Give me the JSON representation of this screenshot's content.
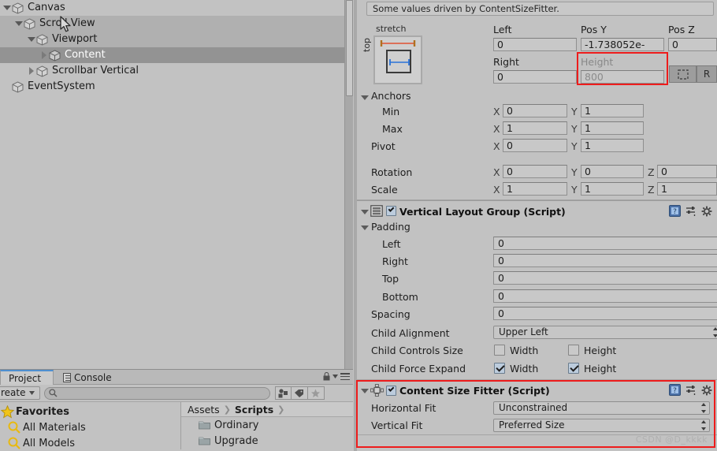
{
  "hierarchy": {
    "rows": [
      {
        "label": "Canvas",
        "indent": 0,
        "fold": "down",
        "state": "normal"
      },
      {
        "label": "Scroll View",
        "indent": 1,
        "fold": "down",
        "state": "light"
      },
      {
        "label": "Viewport",
        "indent": 2,
        "fold": "down",
        "state": "light"
      },
      {
        "label": "Content",
        "indent": 3,
        "fold": "right",
        "state": "dark"
      },
      {
        "label": "Scrollbar Vertical",
        "indent": 2,
        "fold": "right",
        "state": "normal"
      },
      {
        "label": "EventSystem",
        "indent": 0,
        "fold": "none",
        "state": "normal"
      }
    ]
  },
  "project": {
    "tabs": [
      {
        "label": "Project",
        "icon": "none",
        "active": true
      },
      {
        "label": "Console",
        "icon": "console-icon",
        "active": false
      }
    ],
    "toolbar": {
      "create_label": "reate",
      "search_value": "",
      "search_placeholder": ""
    },
    "favorites": {
      "header": "Favorites",
      "items": [
        "All Materials",
        "All Models"
      ]
    },
    "breadcrumb": [
      "Assets",
      "Scripts"
    ],
    "assets": [
      "Ordinary",
      "Upgrade"
    ]
  },
  "inspector": {
    "info_message": "Some values driven by ContentSizeFitter.",
    "anchor_preset": {
      "title": "stretch",
      "side": "top"
    },
    "rect": {
      "left_label": "Left",
      "left_value": "0",
      "posy_label": "Pos Y",
      "posy_value": "-1.738052e-",
      "posz_label": "Pos Z",
      "posz_value": "0",
      "right_label": "Right",
      "right_value": "0",
      "height_label": "Height",
      "height_value": "800",
      "blueprint_label": "",
      "raw_label": "R"
    },
    "anchors": {
      "header": "Anchors",
      "min_label": "Min",
      "min_x": "0",
      "min_y": "1",
      "max_label": "Max",
      "max_x": "1",
      "max_y": "1",
      "pivot_label": "Pivot",
      "pivot_x": "0",
      "pivot_y": "1",
      "rotation_label": "Rotation",
      "rot_x": "0",
      "rot_y": "0",
      "rot_z": "0",
      "scale_label": "Scale",
      "scale_x": "1",
      "scale_y": "1",
      "scale_z": "1",
      "axis_x": "X",
      "axis_y": "Y",
      "axis_z": "Z"
    },
    "vertical_layout_group": {
      "title": "Vertical Layout Group (Script)",
      "enabled": true,
      "padding_header": "Padding",
      "padding": [
        {
          "label": "Left",
          "value": "0"
        },
        {
          "label": "Right",
          "value": "0"
        },
        {
          "label": "Top",
          "value": "0"
        },
        {
          "label": "Bottom",
          "value": "0"
        }
      ],
      "spacing_label": "Spacing",
      "spacing_value": "0",
      "child_alignment_label": "Child Alignment",
      "child_alignment_value": "Upper Left",
      "child_controls_size_label": "Child Controls Size",
      "child_force_expand_label": "Child Force Expand",
      "width_label": "Width",
      "height_label": "Height",
      "controls_width": false,
      "controls_height": false,
      "expand_width": true,
      "expand_height": true
    },
    "content_size_fitter": {
      "title": "Content Size Fitter (Script)",
      "enabled": true,
      "horizontal_fit_label": "Horizontal Fit",
      "horizontal_fit_value": "Unconstrained",
      "vertical_fit_label": "Vertical Fit",
      "vertical_fit_value": "Preferred Size"
    }
  },
  "watermark": "CSDN @D_kkkk",
  "colors": {
    "panel_bg": "#c2c2c2",
    "field_bg": "#c8c8c8",
    "selection_dark": "#939393",
    "selection_light": "#b0b0b0",
    "highlight_red": "#ee1c1c",
    "checkbox_blue": "#bcccdd"
  }
}
